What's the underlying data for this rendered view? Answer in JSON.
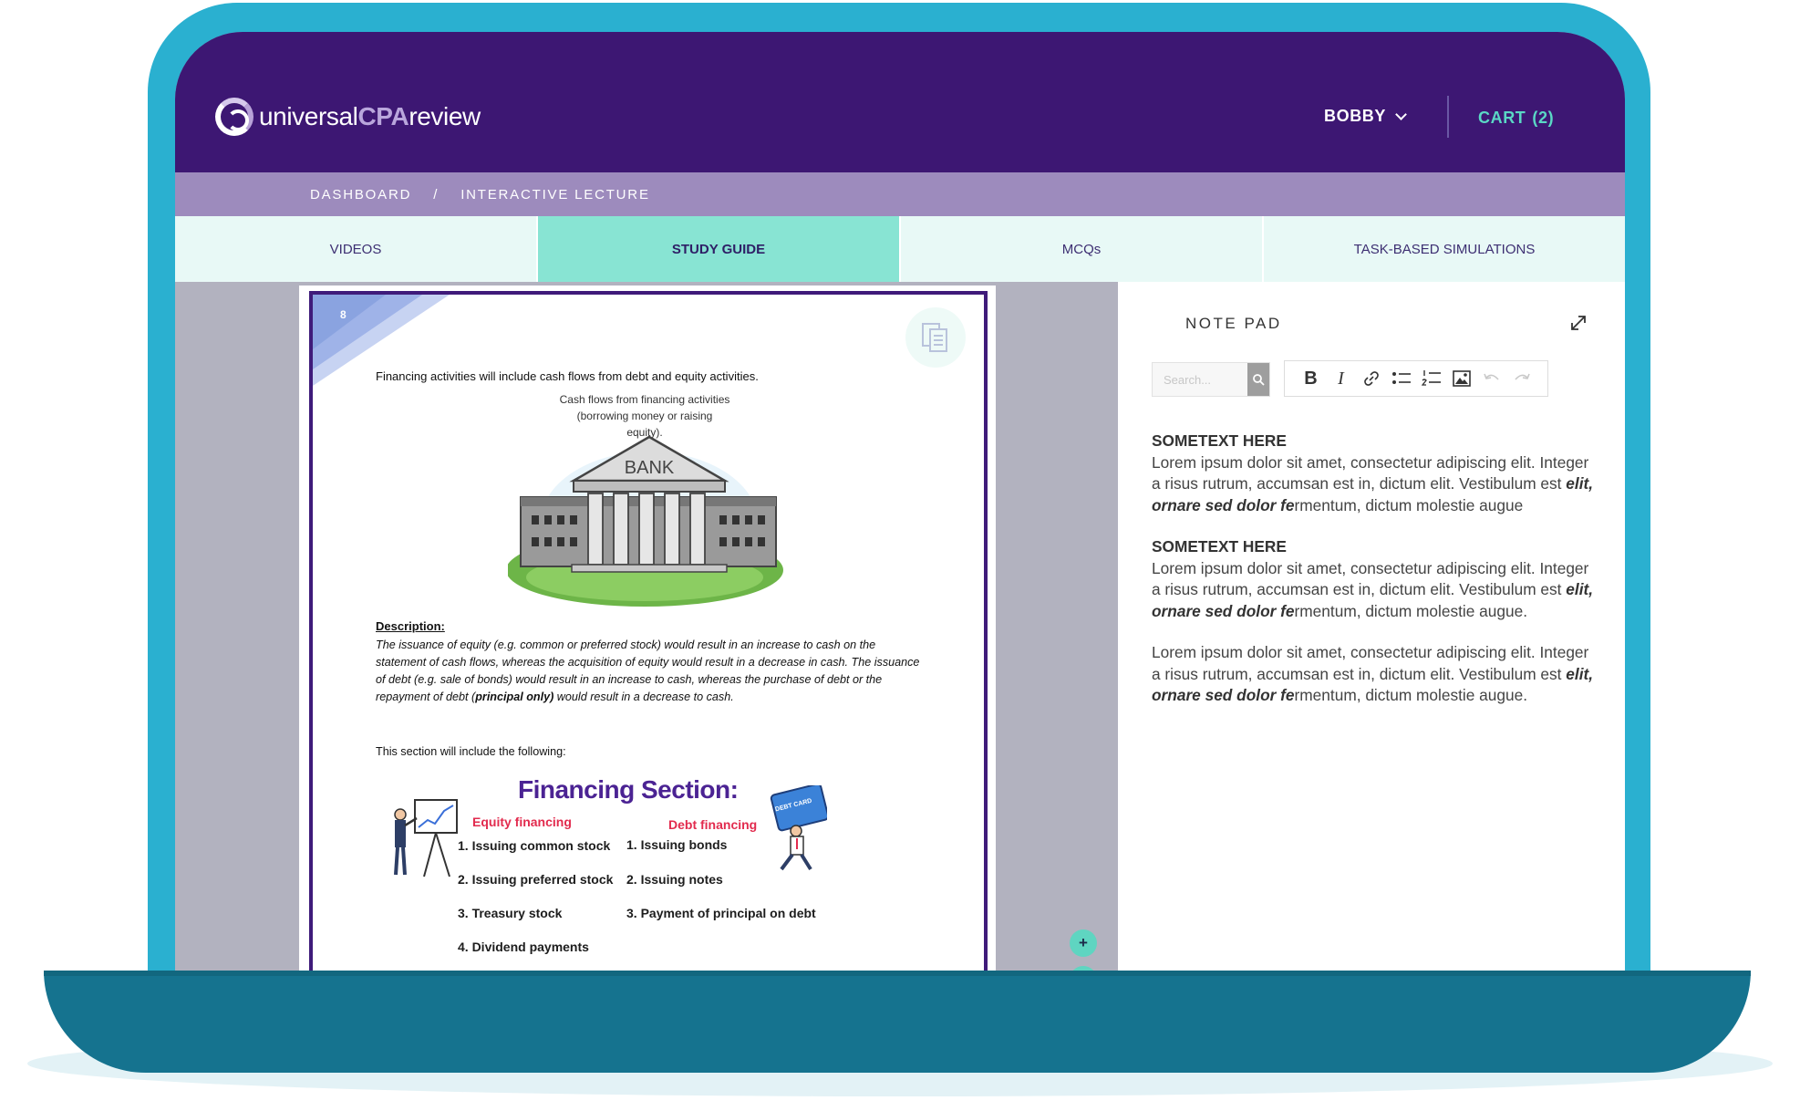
{
  "brand": {
    "name_part1": "universal",
    "name_part2": "CPA",
    "name_part3": "review"
  },
  "header": {
    "user_name": "BOBBY",
    "cart_label": "CART",
    "cart_count": "(2)"
  },
  "breadcrumb": {
    "items": [
      "DASHBOARD",
      "INTERACTIVE LECTURE"
    ],
    "separator": "/"
  },
  "tabs": [
    {
      "label": "VIDEOS",
      "active": false
    },
    {
      "label": "STUDY GUIDE",
      "active": true
    },
    {
      "label": "MCQs",
      "active": false
    },
    {
      "label": "TASK-BASED SIMULATIONS",
      "active": false
    }
  ],
  "document": {
    "page_number": "8",
    "intro": "Financing activities will include cash flows from debt and equity activities.",
    "caption_line1": "Cash flows from financing activities",
    "caption_line2": "(borrowing money or raising equity).",
    "bank_sign": "BANK",
    "description_title": "Description:",
    "description_part1": "The issuance of equity (e.g. common or preferred stock) would result in an increase to cash on the statement of cash flows, whereas the acquisition of equity would result in a decrease in cash. The issuance of debt (e.g. sale of bonds) would result in an increase to cash, whereas the purchase of debt or the repayment of debt (",
    "description_bold": "principal only)",
    "description_part2": " would result in a decrease to cash.",
    "section_intro": "This section will include the following:",
    "financing_title": "Financing Section:",
    "equity_heading": "Equity financing",
    "debt_heading": "Debt financing",
    "credit_card_label": "DEBT CARD",
    "equity_items": [
      "1. Issuing common stock",
      "2. Issuing preferred stock",
      "3. Treasury stock",
      "4. Dividend payments"
    ],
    "debt_items": [
      "1. Issuing bonds",
      "2. Issuing notes",
      "3. Payment of principal on debt"
    ]
  },
  "zoom": {
    "in_label": "+",
    "out_label": "−"
  },
  "notepad": {
    "title": "NOTE PAD",
    "search_placeholder": "Search...",
    "toolbar": {
      "bold": "B",
      "italic": "I"
    },
    "notes": [
      {
        "heading": "SOMETEXT HERE",
        "text_before": "Lorem ipsum dolor sit amet, consectetur adipiscing elit. Integer a risus rutrum, accumsan est in, dictum elit. Vestibulum est ",
        "text_bold": "elit, ornare sed dolor fe",
        "text_after": "rmentum, dictum molestie augue"
      },
      {
        "heading": "SOMETEXT HERE",
        "text_before": "Lorem ipsum dolor sit amet, consectetur adipiscing elit. Integer a risus rutrum, accumsan est in, dictum elit. Vestibulum est ",
        "text_bold": "elit, ornare sed dolor fe",
        "text_after": "rmentum, dictum molestie augue."
      },
      {
        "heading": "",
        "text_before": "Lorem ipsum dolor sit amet, consectetur adipiscing elit. Integer a risus rutrum, accumsan est in, dictum elit. Vestibulum est ",
        "text_bold": "elit, ornare sed dolor fe",
        "text_after": "rmentum, dictum molestie augue."
      }
    ]
  },
  "colors": {
    "header": "#3d1773",
    "breadcrumb": "#9d8bbd",
    "tab_active": "#88e4d3",
    "accent": "#5ad8c5",
    "laptop_lid": "#2ab0d0",
    "laptop_base": "#15738f"
  }
}
